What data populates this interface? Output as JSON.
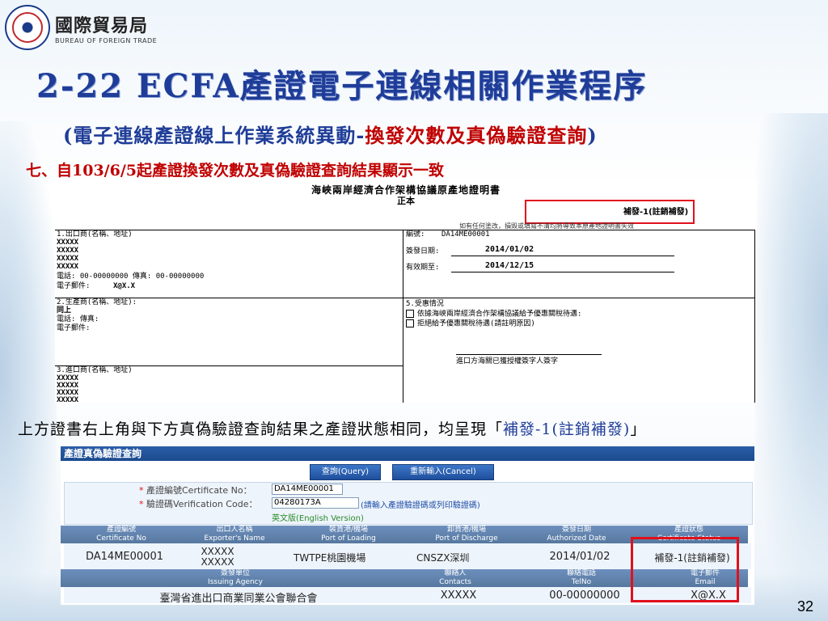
{
  "logo": {
    "name_zh": "國際貿易局",
    "name_en": "BUREAU OF FOREIGN TRADE"
  },
  "title": "2-22 ECFA產證電子連線相關作業程序",
  "subtitle": {
    "open": "(",
    "blue": "電子連線產證線上作業系統異動-",
    "red": "換發次數及真偽驗證查詢",
    "close": ")"
  },
  "point": "七、自103/6/5起產證換發次數及真偽驗證查詢結果顯示一致",
  "certificate": {
    "title": "海峽兩岸經濟合作架構協議原產地證明書",
    "copy": "正本",
    "reissue": "補發-1(註銷補發)",
    "note": "如有任何塗改，損毀或填寫不清均將導致本原產地證明書失效",
    "exporter_label": "1.出口商(名稱、地址)",
    "exporter_lines": [
      "XXXXX",
      "XXXXX",
      "XXXXX",
      "XXXXX"
    ],
    "exporter_contact": "電話: 00-00000000  傳真: 00-00000000",
    "exporter_email_label": "電子郵件:",
    "exporter_email": "X@X.X",
    "cert_no_label": "編號:",
    "cert_no": "DA14ME00001",
    "issue_label": "簽發日期:",
    "issue_date": "2014/01/02",
    "expiry_label": "有效期至:",
    "expiry_date": "2014/12/15",
    "producer_label": "2.生產商(名稱、地址):",
    "producer_name": "同上",
    "producer_phone": "電話:    傳真:",
    "producer_email": "電子郵件:",
    "preferential_label": "5.受惠情況",
    "pref_option1": "依據海峽兩岸經濟合作架構協議給予優惠關稅待遇:",
    "pref_option2": "拒絕給予優惠關稅待遇(請註明原因)",
    "customs_sign": "進口方海關已獲授權簽字人簽字",
    "importer_label": "3.進口商(名稱、地址)",
    "importer_lines": [
      "XXXXX",
      "XXXXX",
      "XXXXX",
      "XXXXX"
    ]
  },
  "caption": {
    "text": "上方證書右上角與下方真偽驗證查詢結果之產證狀態相同，均呈現「",
    "highlight": "補發-1(註銷補發)",
    "close": "」"
  },
  "panel": {
    "header": "產證真偽驗證查詢",
    "query_button": "查詢(Query)",
    "reset_button": "重新輸入(Cancel)",
    "cert_no_label": "產證編號Certificate No：",
    "cert_no_value": "DA14ME00001",
    "verify_label": "驗證碼Verification Code：",
    "verify_value": "04280173A",
    "verify_hint": "(請輸入產證驗證碼或列印驗證碼)",
    "english_link": "英文版(English Version)",
    "columns1": [
      {
        "zh": "產證編號",
        "en": "Certificate No"
      },
      {
        "zh": "出口人名稱",
        "en": "Exporter's Name"
      },
      {
        "zh": "裝貨港/機場",
        "en": "Port of Loading"
      },
      {
        "zh": "卸貨港/機場",
        "en": "Port of Discharge"
      },
      {
        "zh": "簽發日期",
        "en": "Authorized Date"
      },
      {
        "zh": "產證狀態",
        "en": "Certificate Status"
      }
    ],
    "row1": {
      "cert_no": "DA14ME00001",
      "exporter": "XXXXX",
      "exporter2": "XXXXX",
      "loading": "TWTPE桃園機場",
      "discharge": "CNSZX深圳",
      "date": "2014/01/02",
      "status": "補發-1(註銷補發)"
    },
    "columns2": [
      {
        "zh": "簽發單位",
        "en": "Issuing Agency"
      },
      {
        "zh": "聯絡人",
        "en": "Contacts"
      },
      {
        "zh": "聯絡電話",
        "en": "TelNo"
      },
      {
        "zh": "電子郵件",
        "en": "Email"
      }
    ],
    "row2": {
      "agency": "臺灣省進出口商業同業公會聯合會",
      "contact": "XXXXX",
      "tel": "00-00000000",
      "email": "X@X.X"
    }
  },
  "page_number": "32",
  "colors": {
    "title_blue": "#1f3d98",
    "accent_red": "#c00000",
    "highlight_box": "#e0101c"
  }
}
